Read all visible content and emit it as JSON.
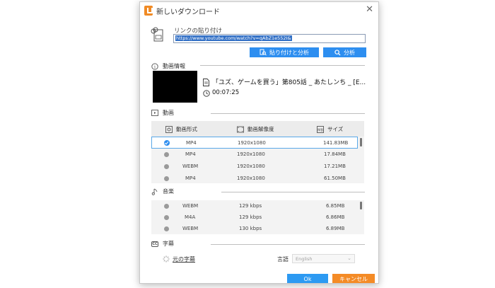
{
  "window": {
    "title": "新しいダウンロード",
    "close_icon": "close-icon",
    "app_icon": "download-app-icon"
  },
  "link": {
    "label": "リンクの貼り付け",
    "url_value": "https://www.youtube.com/watch?v=qAbZ1e552I&",
    "paste_analyze_label": "貼り付けと分析",
    "analyze_label": "分析"
  },
  "video_info": {
    "header": "動画情報",
    "title": "「ユズ、ゲームを買う」第805話 _ あたしンち _ [E...",
    "duration": "00:07:25"
  },
  "video": {
    "header": "動画",
    "columns": [
      "動画形式",
      "動画解像度",
      "サイズ"
    ],
    "rows": [
      {
        "format": "MP4",
        "resolution": "1920x1080",
        "size": "141.83MB",
        "selected": true
      },
      {
        "format": "MP4",
        "resolution": "1920x1080",
        "size": "17.84MB",
        "selected": false
      },
      {
        "format": "WEBM",
        "resolution": "1920x1080",
        "size": "17.21MB",
        "selected": false
      },
      {
        "format": "MP4",
        "resolution": "1920x1080",
        "size": "61.50MB",
        "selected": false
      }
    ]
  },
  "audio": {
    "header": "音楽",
    "rows": [
      {
        "format": "WEBM",
        "bitrate": "129 kbps",
        "size": "6.85MB"
      },
      {
        "format": "M4A",
        "bitrate": "129 kbps",
        "size": "6.86MB"
      },
      {
        "format": "WEBM",
        "bitrate": "130 kbps",
        "size": "6.89MB"
      }
    ]
  },
  "subtitles": {
    "header": "字幕",
    "original_label": "元の字幕",
    "language_label": "言語",
    "language_value": "English"
  },
  "footer": {
    "ok_label": "Ok",
    "cancel_label": "キャンセル"
  },
  "colors": {
    "primary_blue": "#2d8ef0",
    "cancel_orange": "#f48b26",
    "selection_border": "#59a8e8"
  }
}
